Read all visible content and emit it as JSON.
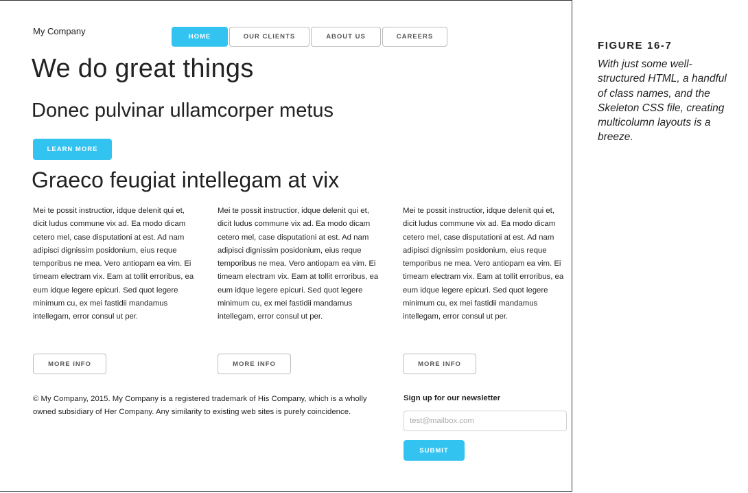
{
  "site": {
    "brand": "My Company"
  },
  "nav": {
    "items": [
      "HOME",
      "OUR CLIENTS",
      "ABOUT US",
      "CAREERS"
    ]
  },
  "hero": {
    "title": "We do great things",
    "subtitle": "Donec pulvinar ullamcorper metus",
    "cta_label": "LEARN MORE"
  },
  "section": {
    "heading": "Graeco feugiat intellegam at vix"
  },
  "columns": [
    {
      "text": "Mei te possit instructior, idque delenit qui et, dicit ludus commune vix ad. Ea modo dicam cetero mel, case disputationi at est. Ad nam adipisci dignissim posidonium, eius reque temporibus ne mea. Vero antiopam ea vim. Ei timeam electram vix. Eam at tollit erroribus, ea eum idque legere epicuri. Sed quot legere minimum cu, ex mei fastidii mandamus intellegam, error consul ut per.",
      "button": "MORE INFO"
    },
    {
      "text": "Mei te possit instructior, idque delenit qui et, dicit ludus commune vix ad. Ea modo dicam cetero mel, case disputationi at est. Ad nam adipisci dignissim posidonium, eius reque temporibus ne mea. Vero antiopam ea vim. Ei timeam electram vix. Eam at tollit erroribus, ea eum idque legere epicuri. Sed quot legere minimum cu, ex mei fastidii mandamus intellegam, error consul ut per.",
      "button": "MORE INFO"
    },
    {
      "text": "Mei te possit instructior, idque delenit qui et, dicit ludus commune vix ad. Ea modo dicam cetero mel, case disputationi at est. Ad nam adipisci dignissim posidonium, eius reque temporibus ne mea. Vero antiopam ea vim. Ei timeam electram vix. Eam at tollit erroribus, ea eum idque legere epicuri. Sed quot legere minimum cu, ex mei fastidii mandamus intellegam, error consul ut per.",
      "button": "MORE INFO"
    }
  ],
  "footer": {
    "copyright": "© My Company, 2015. My Company is a registered trademark of His Company, which is a wholly owned subsidiary of Her Company. Any similarity to existing web sites is purely coincidence."
  },
  "newsletter": {
    "label": "Sign up for our newsletter",
    "placeholder": "test@mailbox.com",
    "submit_label": "SUBMIT"
  },
  "figure": {
    "label": "FIGURE 16-7",
    "caption": "With just some well-structured HTML, a handful of class names, and the Skeleton CSS file, creating multicolumn layouts is a breeze."
  },
  "colors": {
    "accent": "#33c3f0",
    "text": "#222222",
    "border": "#bbbbbb"
  }
}
